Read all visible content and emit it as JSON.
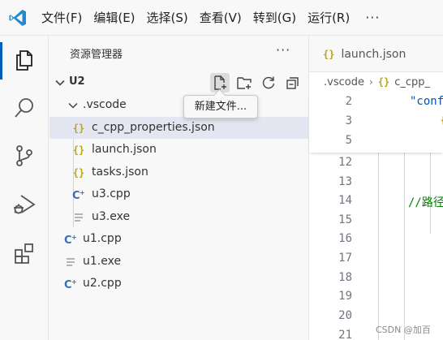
{
  "menu": {
    "logo_icon": "vscode-logo-icon",
    "items": [
      "文件(F)",
      "编辑(E)",
      "选择(S)",
      "查看(V)",
      "转到(G)",
      "运行(R)"
    ],
    "more": "···"
  },
  "activity_bar": {
    "items": [
      "explorer-icon",
      "search-icon",
      "source-control-icon",
      "run-debug-icon",
      "extensions-icon"
    ],
    "active": "explorer-icon"
  },
  "sidebar": {
    "title": "资源管理器",
    "more": "···",
    "root": "U2",
    "root_actions": [
      "new-file-icon",
      "new-folder-icon",
      "refresh-icon",
      "collapse-all-icon"
    ],
    "tooltip": "新建文件...",
    "tree": [
      {
        "label": ".vscode",
        "icon": "chevron-down-icon"
      },
      {
        "label": "c_cpp_properties.json",
        "icon": "json-icon",
        "selected": true
      },
      {
        "label": "launch.json",
        "icon": "json-icon"
      },
      {
        "label": "tasks.json",
        "icon": "json-icon"
      },
      {
        "label": "u3.cpp",
        "icon": "cpp-icon"
      },
      {
        "label": "u3.exe",
        "icon": "exe-icon"
      },
      {
        "label": "u1.cpp",
        "icon": "cpp-icon"
      },
      {
        "label": "u1.exe",
        "icon": "exe-icon"
      },
      {
        "label": "u2.cpp",
        "icon": "cpp-icon"
      }
    ]
  },
  "editor": {
    "tab_label": "launch.json",
    "breadcrumb": [
      ".vscode",
      "c_cpp_"
    ],
    "sticky_lines": [
      {
        "num": "2",
        "text": "\"conf"
      },
      {
        "num": "3",
        "text": "{"
      },
      {
        "num": "5",
        "text": ""
      }
    ],
    "lines": [
      {
        "num": "12",
        "text": ""
      },
      {
        "num": "13",
        "text": ""
      },
      {
        "num": "14",
        "text": "//路径"
      },
      {
        "num": "15",
        "text": ""
      },
      {
        "num": "16",
        "text": ""
      },
      {
        "num": "17",
        "text": ""
      },
      {
        "num": "18",
        "text": ""
      },
      {
        "num": "19",
        "text": ""
      },
      {
        "num": "20",
        "text": ""
      },
      {
        "num": "21",
        "text": ""
      }
    ]
  },
  "watermark": "CSDN @加百",
  "colors": {
    "accent": "#005fb8",
    "selection": "#e4e6f1",
    "json_brace": "#b8a323",
    "cpp_icon": "#2f6fb3",
    "comment": "#008000",
    "string": "#0451a5"
  }
}
